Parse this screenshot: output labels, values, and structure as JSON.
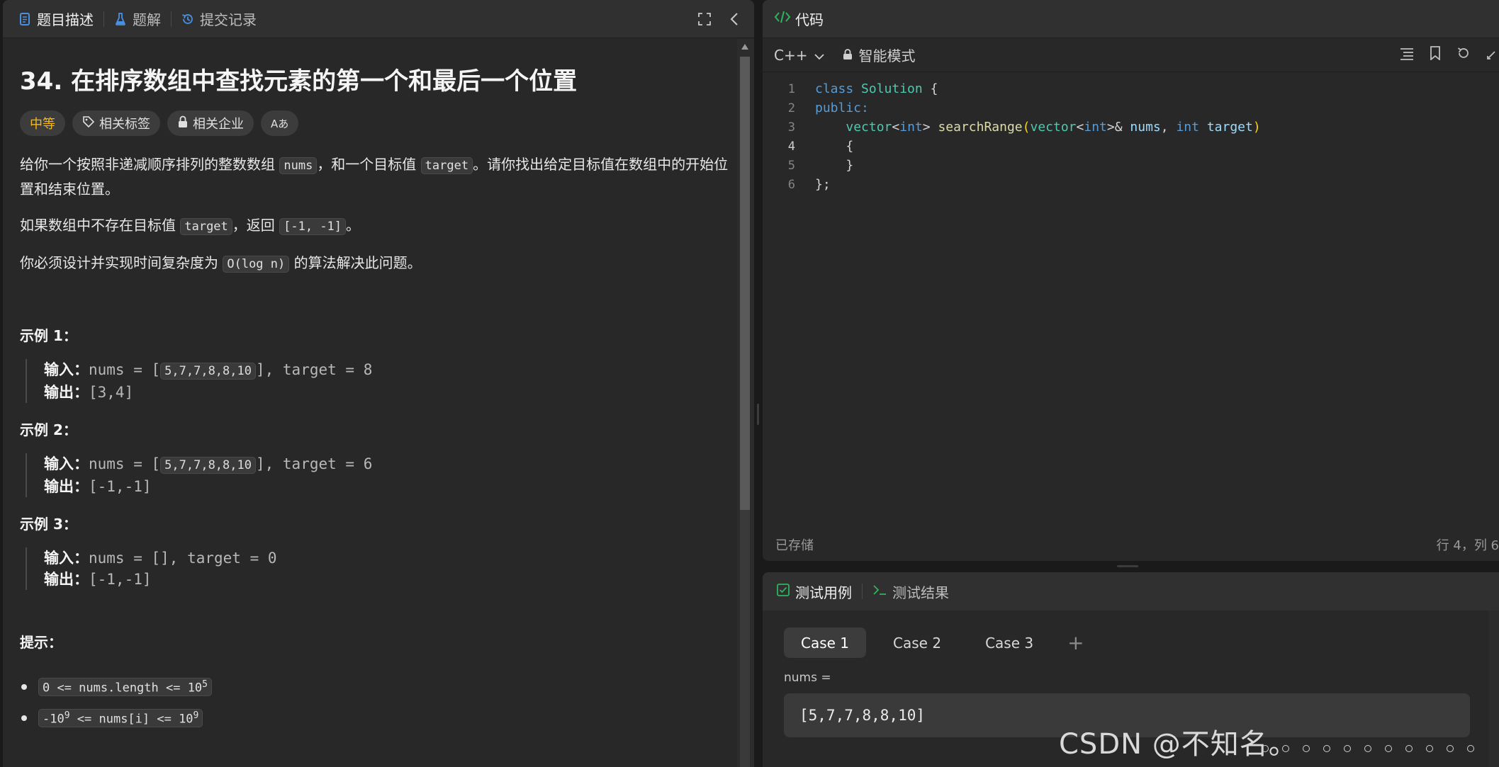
{
  "left_tabs": [
    {
      "label": "题目描述",
      "icon": "document-icon"
    },
    {
      "label": "题解",
      "icon": "flask-icon"
    },
    {
      "label": "提交记录",
      "icon": "history-icon"
    }
  ],
  "problem": {
    "title": "34. 在排序数组中查找元素的第一个和最后一个位置",
    "difficulty": "中等",
    "tag_related": "相关标签",
    "company_related": "相关企业",
    "translate_glyph": "Aあ",
    "p1_a": "给你一个按照非递减顺序排列的整数数组 ",
    "p1_code1": "nums",
    "p1_b": "，和一个目标值 ",
    "p1_code2": "target",
    "p1_c": "。请你找出给定目标值在数组中的开始位置和结束位置。",
    "p2_a": "如果数组中不存在目标值 ",
    "p2_code1": "target",
    "p2_b": "，返回 ",
    "p2_code2": "[-1, -1]",
    "p2_c": "。",
    "p3_a": "你必须设计并实现时间复杂度为 ",
    "p3_code": "O(log n)",
    "p3_b": " 的算法解决此问题。"
  },
  "examples": [
    {
      "title": "示例 1：",
      "in_label": "输入：",
      "in_pre": "nums = [",
      "in_code": "5,7,7,8,8,10",
      "in_post": "], target = 8",
      "out_label": "输出：",
      "out": "[3,4]"
    },
    {
      "title": "示例 2：",
      "in_label": "输入：",
      "in_pre": "nums = [",
      "in_code": "5,7,7,8,8,10",
      "in_post": "], target = 6",
      "out_label": "输出：",
      "out": "[-1,-1]"
    },
    {
      "title": "示例 3：",
      "in_label": "输入：",
      "in_pre": "nums = [], target = 0",
      "out_label": "输出：",
      "out": "[-1,-1]"
    }
  ],
  "hints": {
    "title": "提示：",
    "h1_pre": "0 <= nums.length <= 10",
    "h1_sup": "5",
    "h2_pre": "-10",
    "h2_sup1": "9",
    "h2_mid": " <= nums[i] <= 10",
    "h2_sup2": "9"
  },
  "code_panel": {
    "title": "代码",
    "language": "C++",
    "mode": "智能模式",
    "status": "已存储",
    "cursor": "行 4，列 6"
  },
  "code_lines": [
    "1",
    "2",
    "3",
    "4",
    "5",
    "6"
  ],
  "code_tokens": {
    "l1_kw": "class",
    "l1_ty": "Solution",
    "l1_pu": " {",
    "l2_kw": "public:",
    "l3_ty1": "vector",
    "l3_lt": "<",
    "l3_kw1": "int",
    "l3_gt": ">",
    "l3_fn": "searchRange",
    "l3_op": "(",
    "l3_ty2": "vector",
    "l3_lt2": "<",
    "l3_kw2": "int",
    "l3_gt2": ">&",
    "l3_pr1": "nums",
    "l3_comma": ", ",
    "l3_kw3": "int",
    "l3_pr2": "target",
    "l3_cp": ")",
    "l4": "{",
    "l5": "}",
    "l6": "};"
  },
  "test_panel": {
    "tab_cases": "测试用例",
    "tab_result": "测试结果",
    "cases": [
      "Case 1",
      "Case 2",
      "Case 3"
    ],
    "add_symbol": "+",
    "var_label": "nums =",
    "var_value": "[5,7,7,8,8,10]"
  },
  "watermark": "CSDN @不知名。",
  "colors": {
    "accent_green": "#2db55d",
    "difficulty": "#ffb800",
    "tab_icon_blue": "#4a90e2"
  }
}
